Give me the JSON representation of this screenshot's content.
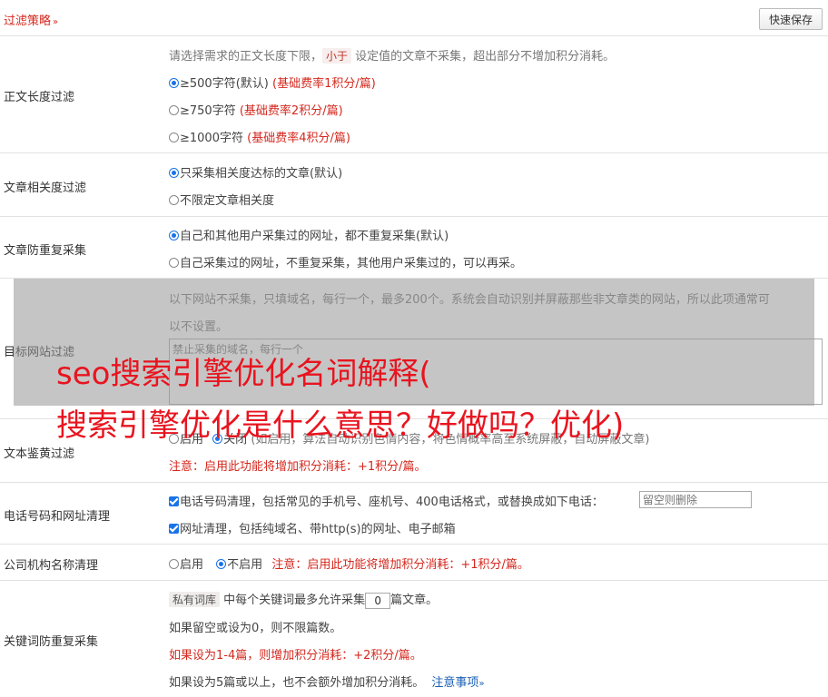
{
  "header": {
    "title": "过滤策略",
    "chevron": "»",
    "quick_save": "快速保存"
  },
  "length_filter": {
    "label": "正文长度过滤",
    "desc_pre": "请选择需求的正文长度下限，",
    "desc_chip": "小于",
    "desc_post": " 设定值的文章不采集，超出部分不增加积分消耗。",
    "options": [
      {
        "text": "≥500字符(默认)",
        "note": "(基础费率1积分/篇)",
        "checked": true
      },
      {
        "text": "≥750字符",
        "note": "(基础费率2积分/篇)",
        "checked": false
      },
      {
        "text": "≥1000字符",
        "note": "(基础费率4积分/篇)",
        "checked": false
      }
    ]
  },
  "relevance_filter": {
    "label": "文章相关度过滤",
    "options": [
      {
        "text": "只采集相关度达标的文章(默认)",
        "checked": true
      },
      {
        "text": "不限定文章相关度",
        "checked": false
      }
    ]
  },
  "dedupe_filter": {
    "label": "文章防重复采集",
    "options": [
      {
        "text": "自己和其他用户采集过的网址，都不重复采集(默认)",
        "checked": true
      },
      {
        "text": "自己采集过的网址，不重复采集，其他用户采集过的，可以再采。",
        "checked": false
      }
    ]
  },
  "site_filter": {
    "label": "目标网站过滤",
    "desc_line1": "以下网站不采集，只填域名，每行一个，最多200个。系统会自动识别并屏蔽那些非文章类的网站，所以此项通常可",
    "desc_line2": "以不设置。",
    "placeholder": "禁止采集的域名，每行一个"
  },
  "porn_filter": {
    "label": "文本鉴黄过滤",
    "opt_on": "启用",
    "opt_off": "关闭",
    "desc": "(如启用，算法自动识别色情内容，将色情概率高至系统屏蔽，自动屏蔽文章)",
    "note": "注意：启用此功能将增加积分消耗：+1积分/篇。"
  },
  "phone_filter": {
    "label": "电话号码和网址清理",
    "phone_text": "电话号码清理，包括常见的手机号、座机号、400电话格式，或替换成如下电话：",
    "phone_placeholder": "留空则删除",
    "url_text": "网址清理，包括纯域名、带http(s)的网址、电子邮箱"
  },
  "org_filter": {
    "label": "公司机构名称清理",
    "opt_on": "启用",
    "opt_off": "不启用",
    "note": "注意：启用此功能将增加积分消耗：+1积分/篇。"
  },
  "keyword_filter": {
    "label": "关键词防重复采集",
    "chip": "私有词库",
    "line1_pre": " 中每个关键词最多允许采集",
    "count": "0",
    "line1_post": "篇文章。",
    "line2": "如果留空或设为0，则不限篇数。",
    "line3": "如果设为1-4篇，则增加积分消耗：+2积分/篇。",
    "line4": "如果设为5篇或以上，也不会额外增加积分消耗。",
    "notice_link": "注意事项",
    "notice_chev": "»"
  },
  "overlay": {
    "line1": "seo搜索引擎优化名词解释(",
    "line2": "搜索引擎优化是什么意思？好做吗？优化)"
  }
}
